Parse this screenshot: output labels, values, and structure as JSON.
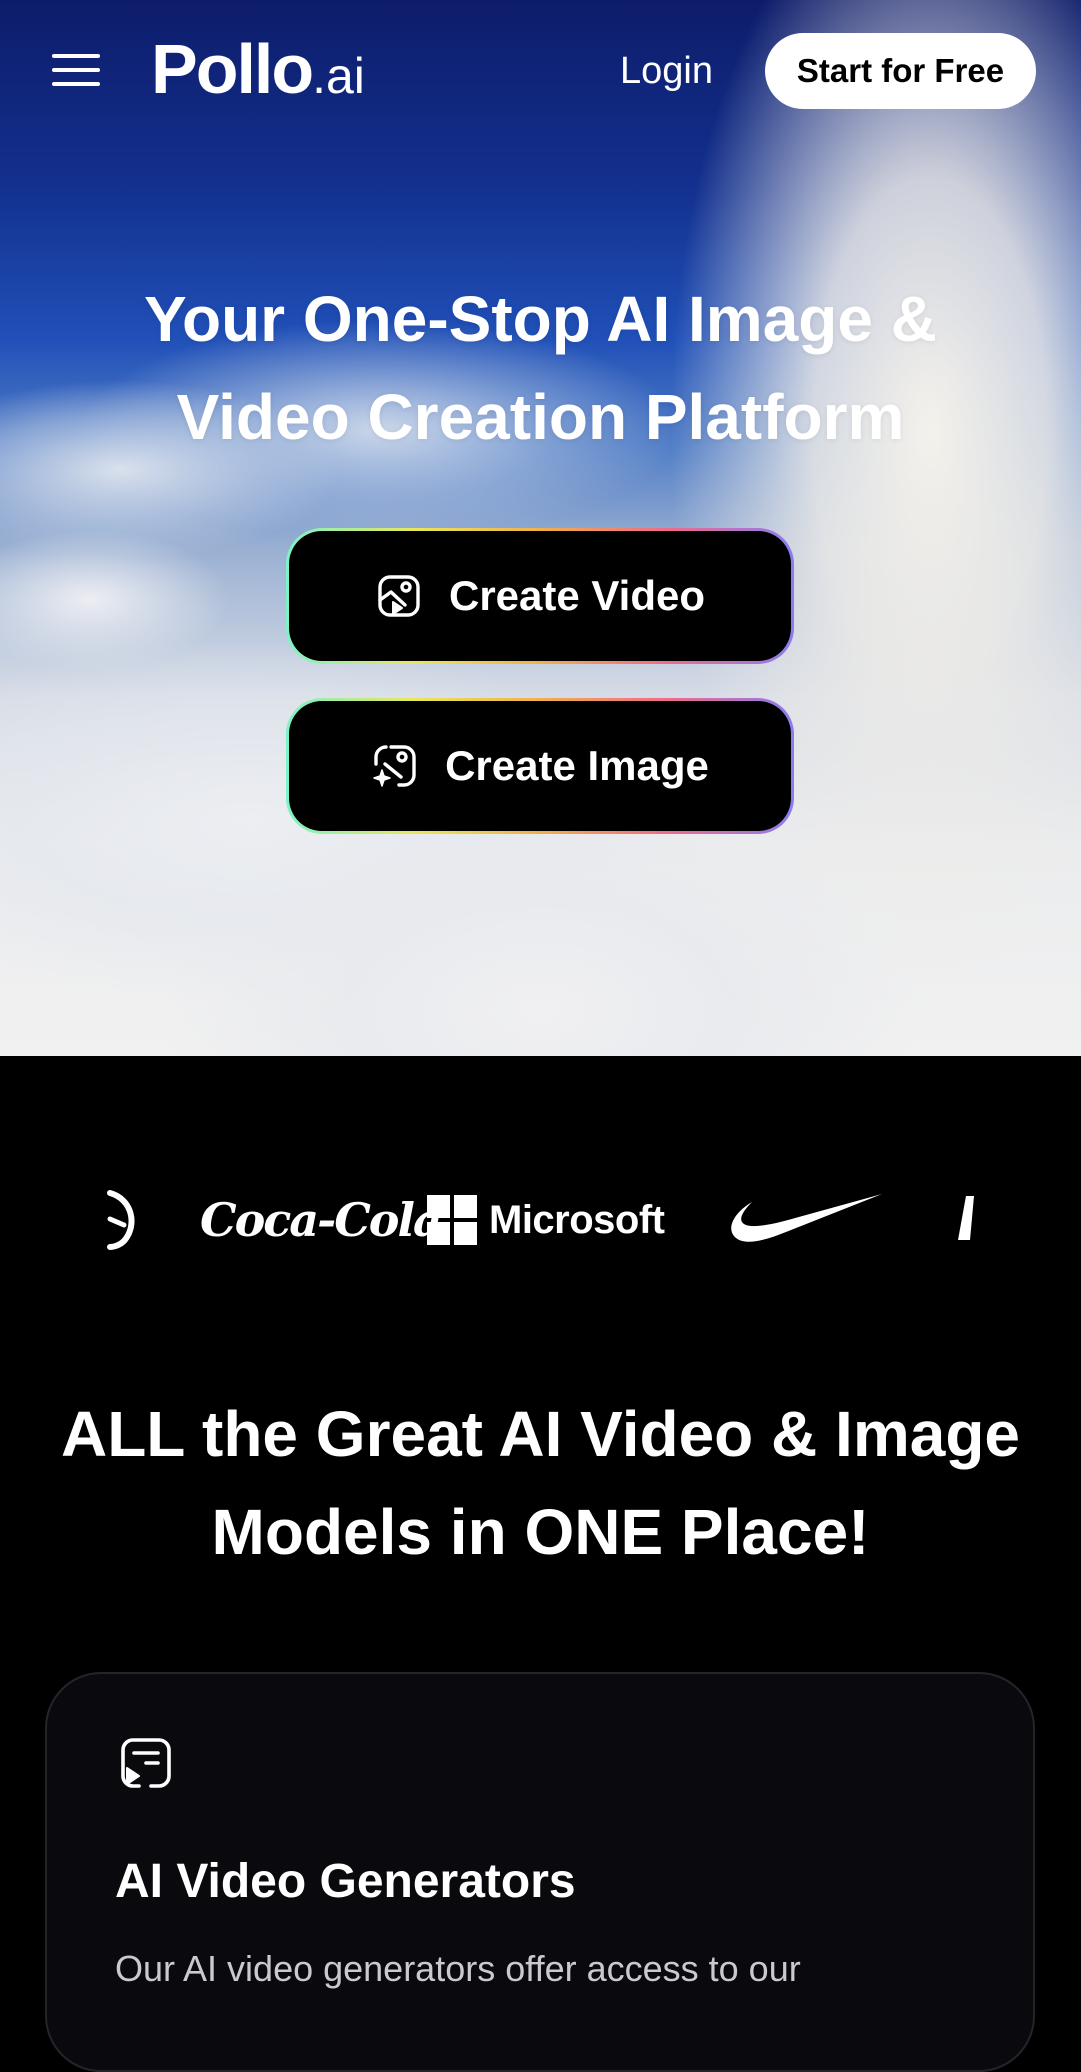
{
  "header": {
    "brand": "Pollo",
    "brand_suffix": ".ai",
    "login_label": "Login",
    "start_label": "Start for Free"
  },
  "hero": {
    "title_line1": "Your One-Stop AI Image &",
    "title_line2": "Video Creation Platform",
    "buttons": [
      {
        "label": "Create Video",
        "icon": "video-icon"
      },
      {
        "label": "Create Image",
        "icon": "image-sparkle-icon"
      }
    ]
  },
  "logos": {
    "items": [
      "partial-logo-left",
      "Coca-Cola",
      "Microsoft",
      "Nike",
      "partial-logo-right"
    ],
    "microsoft_text": "Microsoft",
    "cocacola_text": "Coca-Cola"
  },
  "models_section": {
    "title_line1": "ALL the Great AI Video & Image",
    "title_line2": "Models in ONE Place!",
    "card": {
      "icon": "video-list-icon",
      "title": "AI Video Generators",
      "description": "Our AI video generators offer access to our"
    }
  },
  "colors": {
    "background": "#000000",
    "cta_border_gradient": [
      "#7df2c8",
      "#e8e85a",
      "#f0b04a",
      "#f06a8a",
      "#8a7cf0"
    ],
    "start_button_bg": "#ffffff"
  }
}
